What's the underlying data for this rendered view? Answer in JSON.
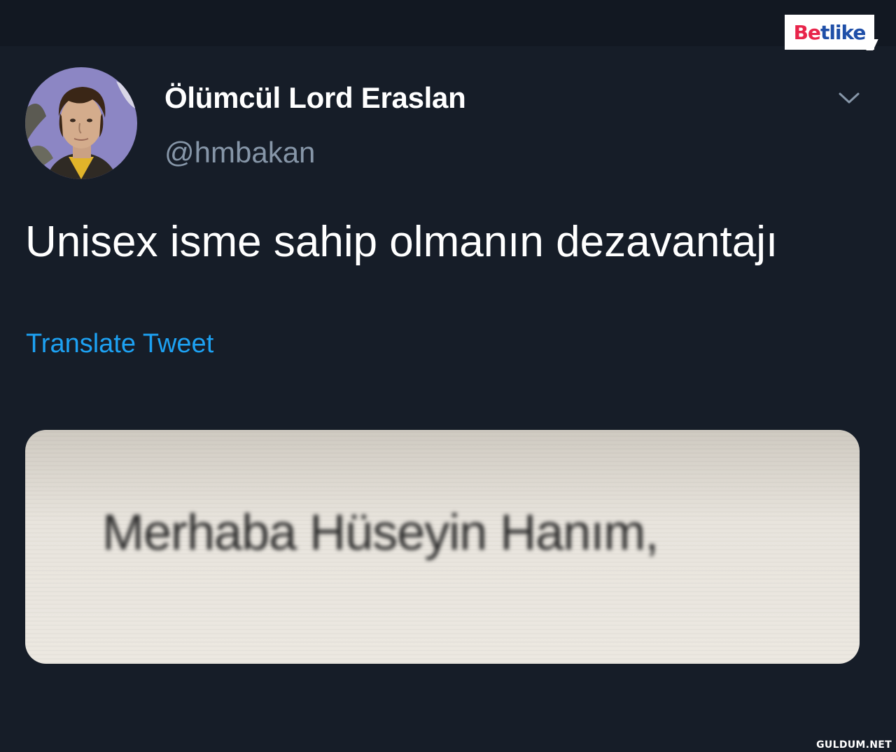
{
  "brand_badge": {
    "part1": "Be",
    "part2": "tlike"
  },
  "tweet": {
    "display_name": "Ölümcül Lord Eraslan",
    "handle": "@hmbakan",
    "text": "Unisex isme sahip olmanın dezavantajı",
    "translate_label": "Translate Tweet",
    "media_text": "Merhaba Hüseyin Hanım,"
  },
  "watermark": "GULDUM.NET",
  "colors": {
    "background": "#161d28",
    "link": "#1da1f2",
    "handle": "#8696a8"
  }
}
